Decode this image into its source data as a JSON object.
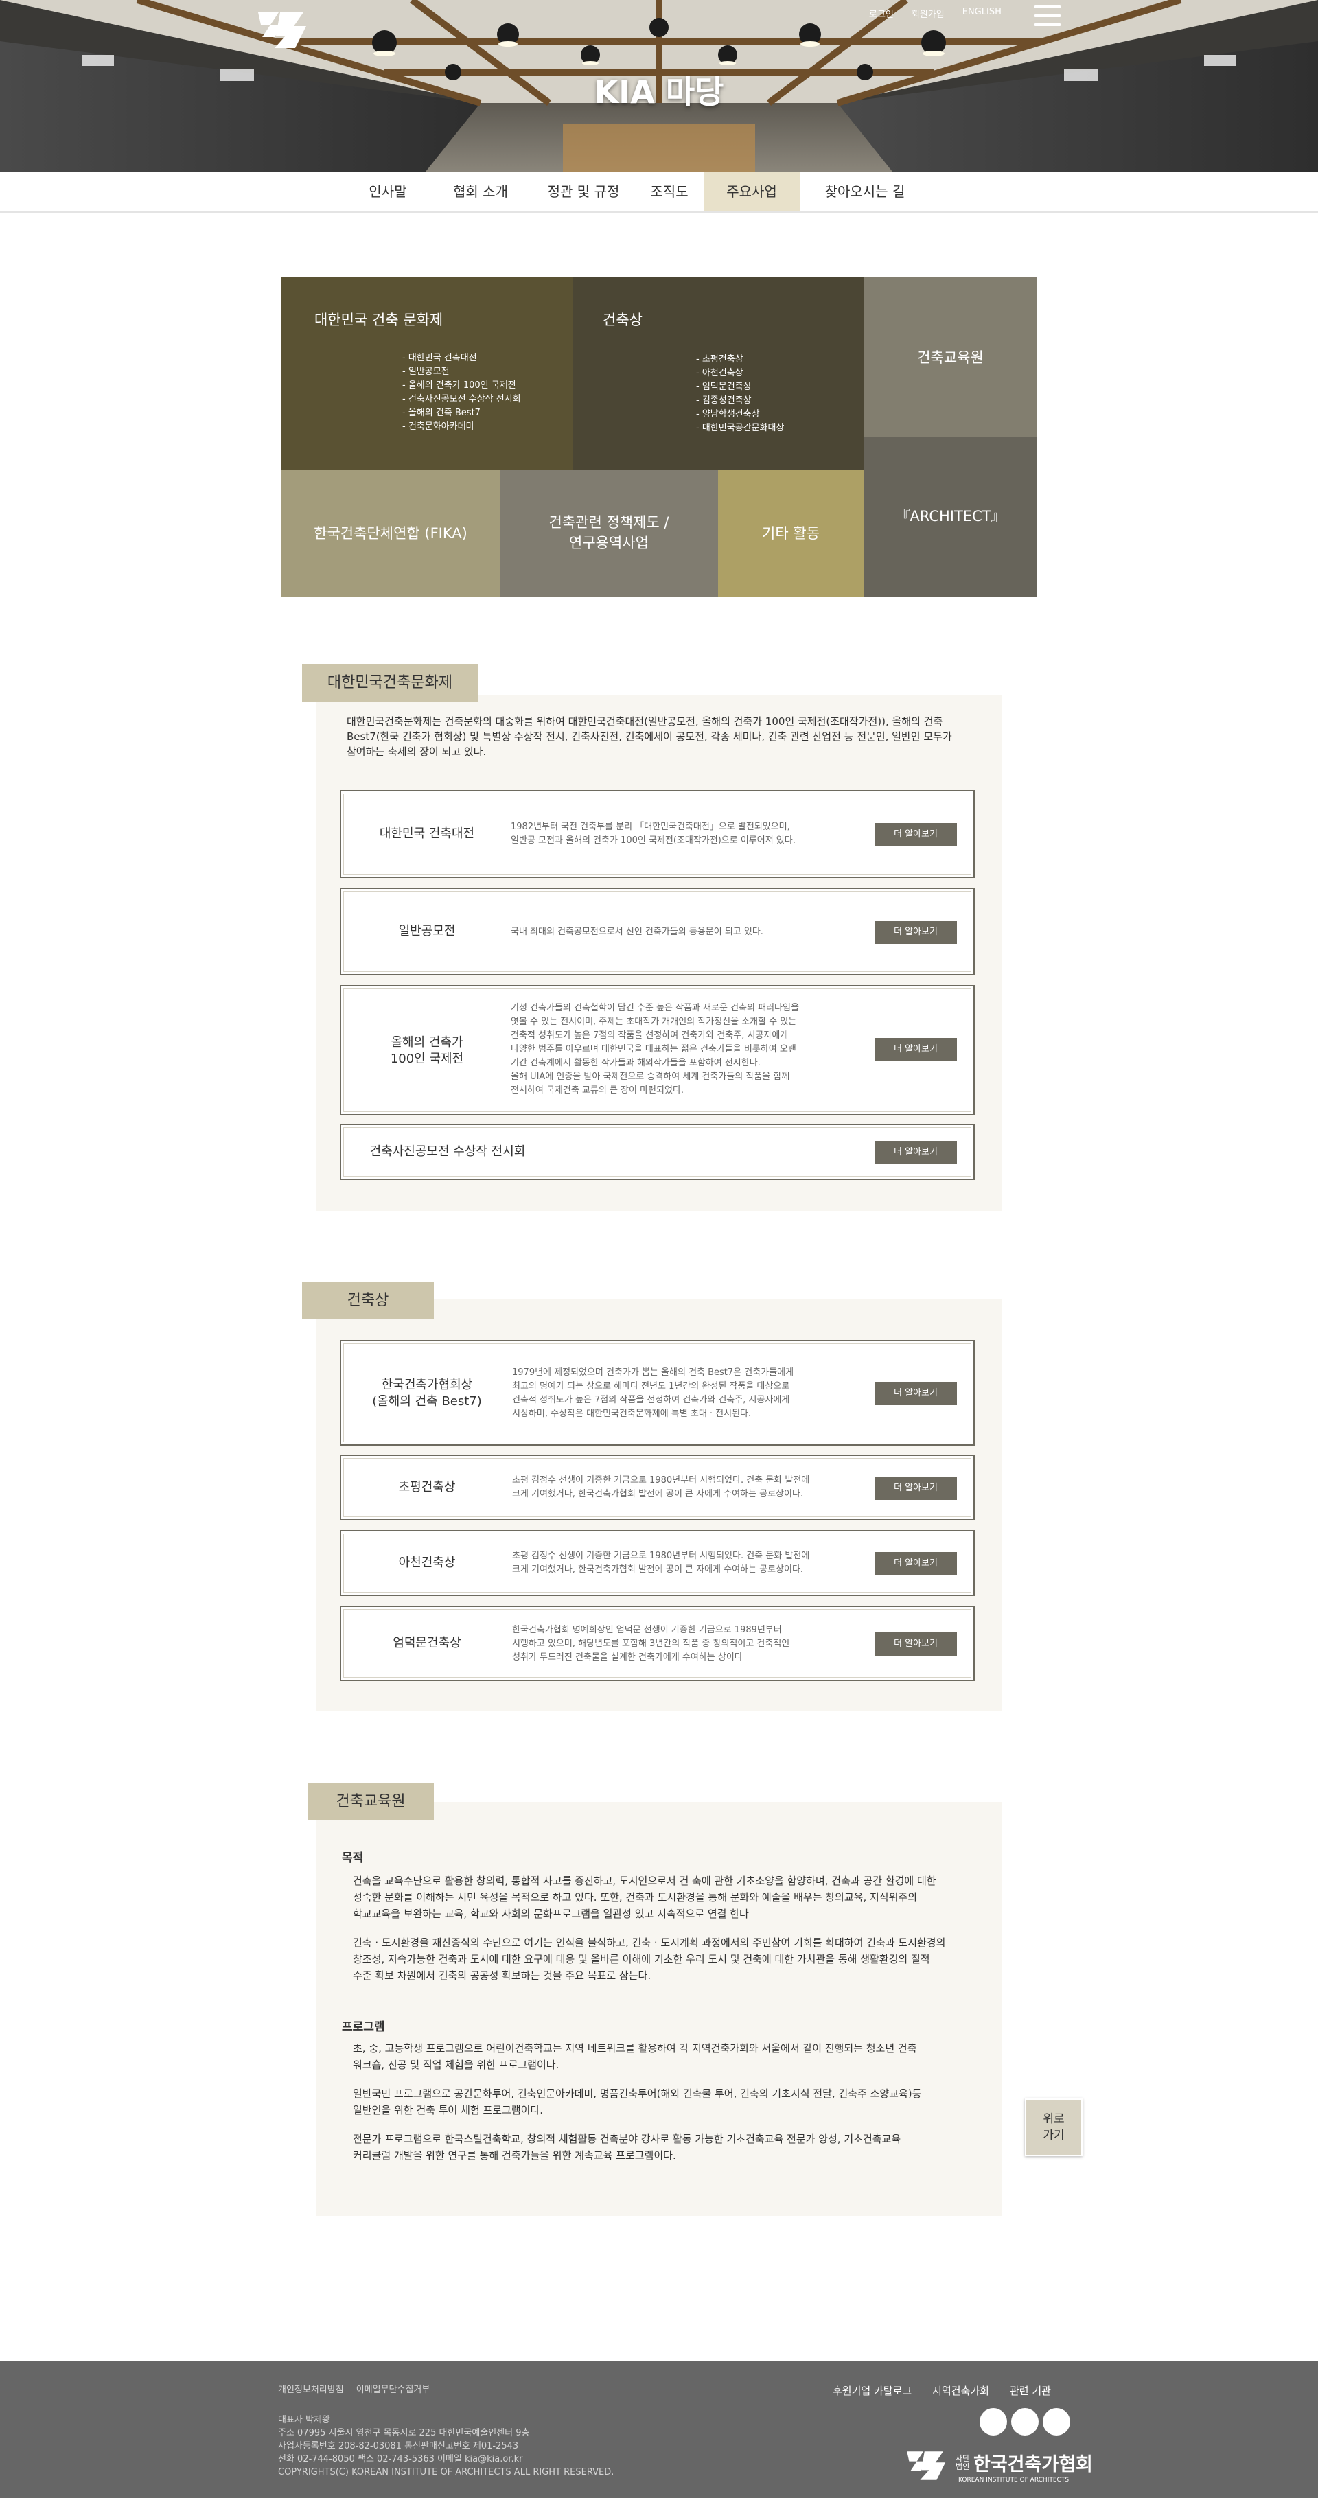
{
  "header": {
    "title": "KIA 마당",
    "top_links": [
      "로그인",
      "회원가입",
      "ENGLISH"
    ],
    "logo_icon": "kia-logo-icon",
    "menu_icon": "hamburger-menu-icon"
  },
  "tabs": [
    {
      "label": "인사말",
      "active": false
    },
    {
      "label": "협회 소개",
      "active": false
    },
    {
      "label": "정관 및 규정",
      "active": false
    },
    {
      "label": "조직도",
      "active": false
    },
    {
      "label": "주요사업",
      "active": true
    },
    {
      "label": "찾아오시는 길",
      "active": false
    }
  ],
  "grid": {
    "culture_festival": {
      "title": "대한민국 건축 문화제",
      "items": [
        "- 대한민국 건축대전",
        "- 일반공모전",
        "- 올해의 건축가 100인 국제전",
        "- 건축사진공모전 수상작 전시회",
        "- 올해의 건축 Best7",
        "- 건축문화아카데미"
      ]
    },
    "award": {
      "title": "건축상",
      "items": [
        "- 초평건축상",
        "- 아천건축상",
        "- 엄덕문건축상",
        "- 김종성건축상",
        "- 양남학생건축상",
        "- 대한민국공간문화대상"
      ]
    },
    "education": "건축교육원",
    "fika": "한국건축단체연합 (FIKA)",
    "policy_line1": "건축관련 정책제도 /",
    "policy_line2": "연구용역사업",
    "etc": "기타 활동",
    "architect": "『ARCHITECT』"
  },
  "section_culture": {
    "tab": "대한민국건축문화제",
    "intro": [
      "대한민국건축문화제는 건축문화의 대중화를 위하여 대한민국건축대전(일반공모전, 올해의 건축가 100인 국제전(조대작가전)), 올해의 건축",
      "Best7(한국 건축가 협회상) 및 특별상 수상작 전시, 건축사진전, 건축에세이 공모전, 각종 세미나, 건축 관련 산업전 등 전문인, 일반인 모두가",
      "참여하는 축제의 장이 되고 있다."
    ],
    "cards": [
      {
        "name1": "대한민국 건축대전",
        "name2": "",
        "desc": [
          "1982년부터 국전 건축부를 분리 「대한민국건축대전」으로 발전되었으며,",
          "일반공 모전과 올해의 건축가 100인 국제전(조대작가전)으로 이루어져 있다."
        ]
      },
      {
        "name1": "일반공모전",
        "name2": "",
        "desc": [
          "국내 최대의 건축공모전으로서 신인 건축가들의 등용문이 되고 있다."
        ]
      },
      {
        "name1": "올해의 건축가",
        "name2": "100인 국제전",
        "desc": [
          "기성 건축가들의 건축철학이 담긴 수준 높은 작품과 새로운 건축의 패러다임을",
          "엿볼 수 있는 전시이며, 주제는 초대작가 개개인의 작가정신을 소개할 수 있는",
          "건축적 성취도가 높은 7점의 작품을 선정하여 건축가와 건축주, 시공자에게",
          "다양한 범주를 아우르며 대한민국을 대표하는 젊은 건축가들을 비롯하여 오랜",
          "기간 건축계에서 활동한 작가들과 해외작가들을 포함하여 전시한다.",
          "올해 UIA에 인증을 받아 국제전으로 승격하여 세계 건축가들의 작품을 함께",
          "전시하여 국제건축 교류의 큰 장이 마련되었다."
        ]
      },
      {
        "name1": "건축사진공모전 수상작 전시회",
        "name2": "",
        "desc": []
      }
    ],
    "more_label": "더 알아보기"
  },
  "section_award": {
    "tab": "건축상",
    "cards": [
      {
        "name1": "한국건축가협회상",
        "name2": "(올해의 건축 Best7)",
        "desc": [
          "1979년에 제정되었으며 건축가가 뽑는 올해의 건축 Best7은 건축가들에게",
          "최고의 명예가 되는 상으로 해마다 전년도 1년간의 완성된 작품을 대상으로",
          "건축적 성취도가 높은 7점의 작품을 선정하여 건축가와 건축주, 시공자에게",
          "시상하며, 수상작은 대한민국건축문화제에 특별 초대 · 전시된다."
        ]
      },
      {
        "name1": "초평건축상",
        "name2": "",
        "desc": [
          "초평 김정수 선생이 기증한 기금으로 1980년부터 시행되었다. 건축 문화 발전에",
          "크게 기여했거나, 한국건축가협회 발전에 공이 큰 자에게 수여하는 공로상이다."
        ]
      },
      {
        "name1": "아천건축상",
        "name2": "",
        "desc": [
          "초평 김정수 선생이 기증한 기금으로 1980년부터 시행되었다. 건축 문화 발전에",
          "크게 기여했거나, 한국건축가협회 발전에 공이 큰 자에게 수여하는 공로상이다."
        ]
      },
      {
        "name1": "엄덕문건축상",
        "name2": "",
        "desc": [
          "한국건축가협회 명예회장인 엄덕문 선생이 기증한 기금으로 1989년부터",
          "시행하고 있으며, 해당년도를 포함해 3년간의 작품 중 창의적이고 건축적인",
          "성취가 두드러진 건축물을 설계한 건축가에게 수여하는 상이다"
        ]
      }
    ],
    "more_label": "더 알아보기"
  },
  "section_edu": {
    "tab": "건축교육원",
    "purpose_title": "목적",
    "purpose": [
      [
        "건축을 교육수단으로 활용한 창의력, 통합적 사고를 증진하고, 도시인으로서 건 축에 관한 기초소양을 함양하며, 건축과 공간 환경에 대한",
        "성숙한 문화를 이해하는 시민 육성을 목적으로 하고 있다. 또한, 건축과 도시환경을 통해 문화와 예술을 배우는 창의교육, 지식위주의",
        "학교교육을 보완하는 교육, 학교와 사회의 문화프로그램을 일관성 있고 지속적으로 연결 한다"
      ],
      [
        "건축 · 도시환경을 재산증식의 수단으로 여기는 인식을 불식하고, 건축 · 도시계획 과정에서의 주민참여 기회를 확대하여 건축과 도시환경의",
        "창조성, 지속가능한 건축과 도시에 대한 요구에 대응 및 올바른 이해에 기초한 우리 도시 및 건축에 대한 가치관을 통해 생활환경의 질적",
        "수준 확보 차원에서 건축의 공공성 확보하는 것을 주요 목표로 삼는다."
      ]
    ],
    "program_title": "프로그램",
    "program": [
      [
        "초, 중, 고등학생 프로그램으로 어린이건축학교는 지역 네트워크를 활용하여 각 지역건축가회와 서울에서 같이 진행되는 청소년 건축",
        "워크숍, 진공 및 직업 체험을 위한 프로그램이다."
      ],
      [
        "일반국민 프로그램으로 공간문화투어, 건축인문아카데미, 명품건축투어(해외 건축물 투어, 건축의 기초지식 전달, 건축주 소양교육)등",
        "일반인을 위한 건축 투어 체험 프로그램이다."
      ],
      [
        "전문가 프로그램으로 한국스틸건축학교, 창의적 체험활동 건축분야 강사로 활동 가능한 기초건축교육 전문가 양성, 기초건축교육",
        "커리큘럼 개발을 위한 연구를 통해 건축가들을 위한 계속교육 프로그램이다."
      ]
    ]
  },
  "top_button": [
    "위로",
    "가기"
  ],
  "footer": {
    "policy_links": [
      "개인정보처리방침",
      "이메일무단수집거부"
    ],
    "info": [
      "대표자 박제왕",
      "주소 07995 서울시 영천구 목동서로 225 대한민국예술인센터 9층",
      "사업자등록번호 208-82-03081    통신판매신고번호 제01-2543",
      "전화 02-744-8050    팩스 02-743-5363    이메일 kia@kia.or.kr",
      "COPYRIGHTS(C) KOREAN INSTITUTE OF ARCHITECTS ALL RIGHT RESERVED."
    ],
    "links": [
      "후원기업 카탈로그",
      "지역건축가회",
      "관련 기관"
    ],
    "org_small": "사단\n법인",
    "org_name": "한국건축가협회",
    "org_en": "KOREAN INSTITUTE OF ARCHITECTS"
  }
}
